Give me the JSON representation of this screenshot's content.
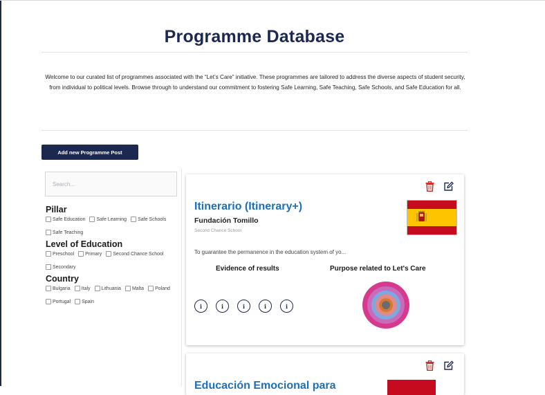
{
  "page": {
    "title": "Programme Database",
    "intro": "Welcome to our curated list of programmes associated with the “Let’s Care” initiative. These programmes are tailored to address the diverse aspects of student security, from individual to political levels. Browse through to understand our commitment to fostering Safe Learning, Safe Teaching, Safe Schools, and Safe Education for all.",
    "add_button": "Add new Programme Post"
  },
  "search": {
    "placeholder": "Search..."
  },
  "filters": [
    {
      "heading": "Pillar",
      "options": [
        "Safe Education",
        "Safe Learning",
        "Safe Schools",
        "Safe Teaching"
      ]
    },
    {
      "heading": "Level of Education",
      "options": [
        "Preschool",
        "Primary",
        "Second Chance School",
        "Secondary"
      ]
    },
    {
      "heading": "Country",
      "options": [
        "Bulgaria",
        "Italy",
        "Lithuania",
        "Malta",
        "Poland",
        "Portugal",
        "Spain"
      ]
    }
  ],
  "cards": [
    {
      "title": "Itinerario (Itinerary+)",
      "organization": "Fundación Tomillo",
      "level": "Second Chance School",
      "description": "To guarantee the permanence in the education system of yo...",
      "evidence_heading": "Evidence of results",
      "purpose_heading": "Purpose related to Let's Care",
      "info_icons": [
        "i",
        "i",
        "i",
        "i",
        "i"
      ],
      "flag": "spain-flag",
      "target_colors": [
        "#d63a8f",
        "#c86bbb",
        "#7fa7e0",
        "#e28a8a",
        "#d9772e",
        "#6b6b6b"
      ]
    },
    {
      "title": "Educación Emocional para",
      "flag": "spain-flag"
    }
  ],
  "colors": {
    "navy": "#1c2850",
    "link_blue": "#1f6fb5",
    "delete_red": "#d0241c"
  }
}
